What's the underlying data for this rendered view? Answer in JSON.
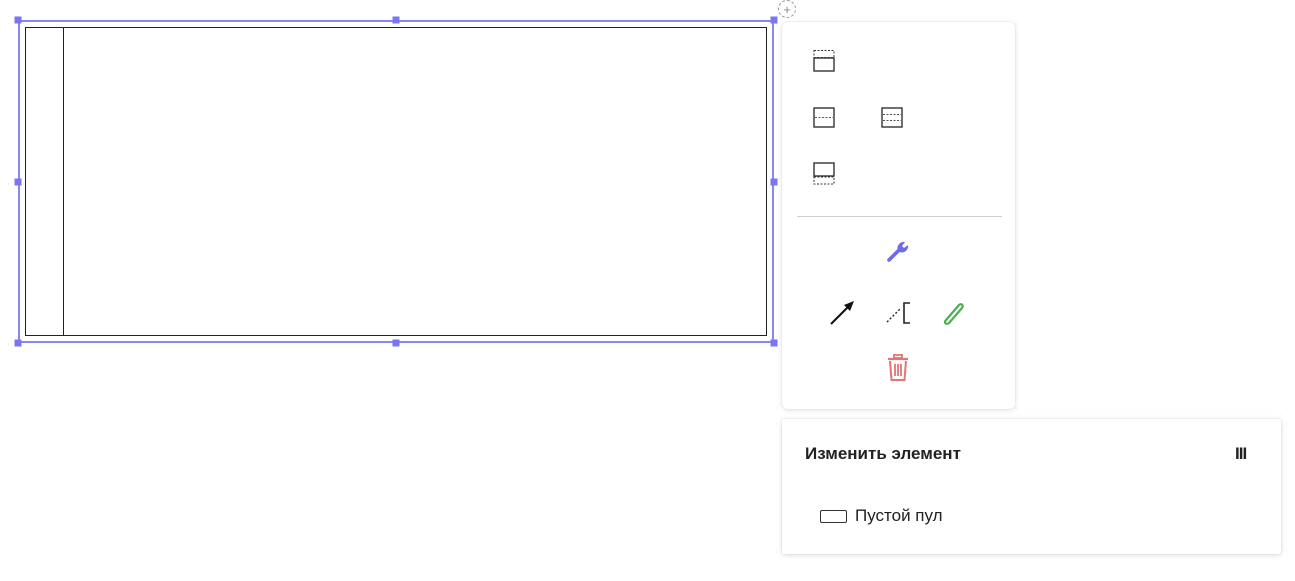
{
  "canvas": {
    "colors": {
      "selection": "#7b75f0",
      "wrench": "#6f6be8",
      "edit": "#4caf50",
      "delete": "#e57373"
    }
  },
  "context_pad": {
    "items": [
      {
        "name": "add-lane-above-icon"
      },
      {
        "name": "split-lane-two-icon"
      },
      {
        "name": "split-lane-three-icon"
      },
      {
        "name": "add-lane-below-icon"
      },
      {
        "name": "wrench-icon"
      },
      {
        "name": "connect-arrow-icon"
      },
      {
        "name": "text-annotation-icon"
      },
      {
        "name": "pencil-icon"
      },
      {
        "name": "trash-icon"
      }
    ]
  },
  "popup_menu": {
    "title": "Изменить элемент",
    "menu_glyph": "III",
    "items": [
      {
        "label": "Пустой пул",
        "icon": "empty-pool-icon"
      }
    ]
  }
}
